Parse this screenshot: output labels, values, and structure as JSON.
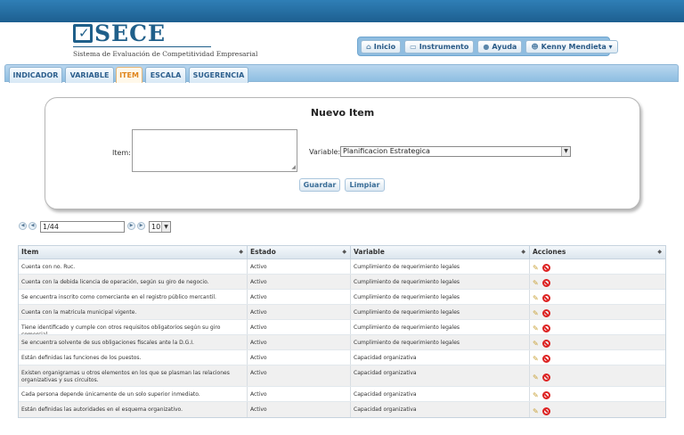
{
  "header": {
    "logo_word": "SECE",
    "logo_subtitle": "Sistema de Evaluación de Competitividad Empresarial"
  },
  "topnav": [
    {
      "icon": "home-icon",
      "glyph": "⌂",
      "label": "Inicio"
    },
    {
      "icon": "document-icon",
      "glyph": "▭",
      "label": "Instrumento"
    },
    {
      "icon": "help-icon",
      "glyph": "●",
      "label": "Ayuda"
    },
    {
      "icon": "user-icon",
      "glyph": "☻",
      "label": "Kenny Mendieta ▾"
    }
  ],
  "tabs": [
    {
      "label": "INDICADOR",
      "active": false
    },
    {
      "label": "VARIABLE",
      "active": false
    },
    {
      "label": "ITEM",
      "active": true
    },
    {
      "label": "ESCALA",
      "active": false
    },
    {
      "label": "SUGERENCIA",
      "active": false
    }
  ],
  "form": {
    "title": "Nuevo Item",
    "item_label": "Item:",
    "item_value": "",
    "variable_label": "Variable:",
    "variable_selected": "Planificacion Estrategica",
    "save_label": "Guardar",
    "clear_label": "Limpiar"
  },
  "pager": {
    "page": "1/44",
    "rows_per_page": "10"
  },
  "grid": {
    "columns": [
      "Item",
      "Estado",
      "Variable",
      "Acciones"
    ],
    "rows": [
      {
        "item": "Cuenta con no. Ruc.",
        "estado": "Activo",
        "variable": "Cumplimiento de requerimiento legales"
      },
      {
        "item": "Cuenta con la debida licencia de operación, según su giro de negocio.",
        "estado": "Activo",
        "variable": "Cumplimiento de requerimiento legales"
      },
      {
        "item": "Se encuentra inscrito como comerciante en el registro público mercantil.",
        "estado": "Activo",
        "variable": "Cumplimiento de requerimiento legales"
      },
      {
        "item": "Cuenta con la matricula municipal vigente.",
        "estado": "Activo",
        "variable": "Cumplimiento de requerimiento legales"
      },
      {
        "item": "Tiene identificado y cumple con otros requisitos obligatorios según su giro comercial.",
        "estado": "Activo",
        "variable": "Cumplimiento de requerimiento legales"
      },
      {
        "item": "Se encuentra solvente de sus obligaciones fiscales ante la D.G.I.",
        "estado": "Activo",
        "variable": "Cumplimiento de requerimiento legales"
      },
      {
        "item": "Están definidas las funciones de los puestos.",
        "estado": "Activo",
        "variable": "Capacidad organizativa"
      },
      {
        "item": "Existen organigramas u otros elementos en los que se plasman las relaciones organizativas y sus circuitos.",
        "estado": "Activo",
        "variable": "Capacidad organizativa"
      },
      {
        "item": "Cada persona depende únicamente de un solo superior inmediato.",
        "estado": "Activo",
        "variable": "Capacidad organizativa"
      },
      {
        "item": "Están definidas las autoridades en el esquema organizativo.",
        "estado": "Activo",
        "variable": "Capacidad organizativa"
      }
    ]
  }
}
